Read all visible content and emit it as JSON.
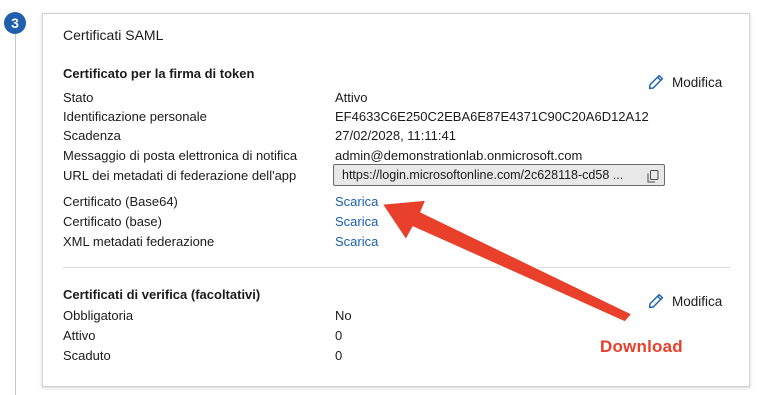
{
  "step": {
    "number": "3"
  },
  "card": {
    "title": "Certificati SAML",
    "token_section": {
      "title": "Certificato per la firma di token",
      "edit_label": "Modifica",
      "rows": [
        {
          "label": "Stato",
          "value": "Attivo"
        },
        {
          "label": "Identificazione personale",
          "value": "EF4633C6E250C2EBA6E87E4371C90C20A6D12A12"
        },
        {
          "label": "Scadenza",
          "value": "27/02/2028, 11:11:41"
        },
        {
          "label": "Messaggio di posta elettronica di notifica",
          "value": "admin@demonstrationlab.onmicrosoft.com"
        },
        {
          "label": "URL dei metadati di federazione dell'app",
          "value": "https://login.microsoftonline.com/2c628118-cd58 ..."
        },
        {
          "label": "Certificato (Base64)",
          "value": "Scarica"
        },
        {
          "label": "Certificato (base)",
          "value": "Scarica"
        },
        {
          "label": "XML metadati federazione",
          "value": "Scarica"
        }
      ]
    },
    "verify_section": {
      "title": "Certificati di verifica (facoltativi)",
      "edit_label": "Modifica",
      "rows": [
        {
          "label": "Obbligatoria",
          "value": "No"
        },
        {
          "label": "Attivo",
          "value": "0"
        },
        {
          "label": "Scaduto",
          "value": "0"
        }
      ]
    }
  },
  "annotation": {
    "label": "Download",
    "color": "#e8402a"
  },
  "colors": {
    "link": "#1a5fb4",
    "badge": "#1f5fae"
  }
}
